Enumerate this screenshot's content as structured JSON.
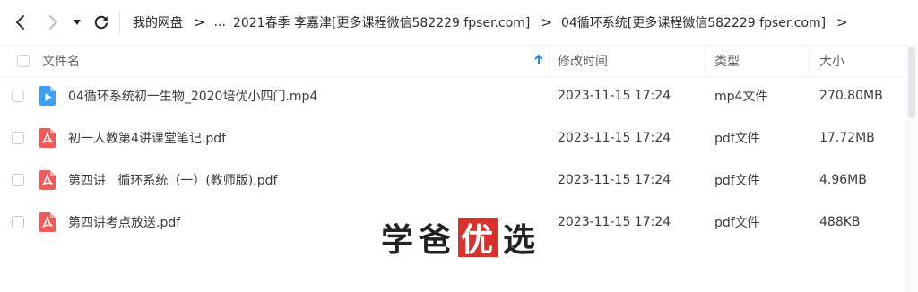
{
  "nav": {
    "back_icon": "chevron-left-icon",
    "forward_icon": "chevron-right-icon",
    "dropdown_icon": "caret-down-icon",
    "refresh_icon": "refresh-icon"
  },
  "breadcrumb": {
    "items": [
      "我的网盘",
      "...",
      "2021春季 李嘉津[更多课程微信582229 fpser.com]",
      "04循环系统[更多课程微信582229 fpser.com]"
    ],
    "separator": ">"
  },
  "table": {
    "columns": {
      "name": "文件名",
      "modified": "修改时间",
      "type": "类型",
      "size": "大小"
    },
    "sort_icon": "arrow-up-icon",
    "rows": [
      {
        "name": "04循环系统初一生物_2020培优小四门.mp4",
        "modified": "2023-11-15 17:24",
        "type": "mp4文件",
        "size": "270.80MB",
        "icon": "video-file-icon"
      },
      {
        "name": "初一人教第4讲课堂笔记.pdf",
        "modified": "2023-11-15 17:24",
        "type": "pdf文件",
        "size": "17.72MB",
        "icon": "pdf-file-icon"
      },
      {
        "name": "第四讲   循环系统（一）(教师版).pdf",
        "modified": "2023-11-15 17:24",
        "type": "pdf文件",
        "size": "4.96MB",
        "icon": "pdf-file-icon"
      },
      {
        "name": "第四讲考点放送.pdf",
        "modified": "2023-11-15 17:24",
        "type": "pdf文件",
        "size": "488KB",
        "icon": "pdf-file-icon"
      }
    ]
  },
  "watermark": {
    "chars": [
      "学",
      "爸",
      "优",
      "选"
    ]
  },
  "colors": {
    "accent": "#1e88e5",
    "video_icon": "#3d9ff0",
    "pdf_icon": "#f05a5a",
    "watermark_box": "#d9312b"
  }
}
